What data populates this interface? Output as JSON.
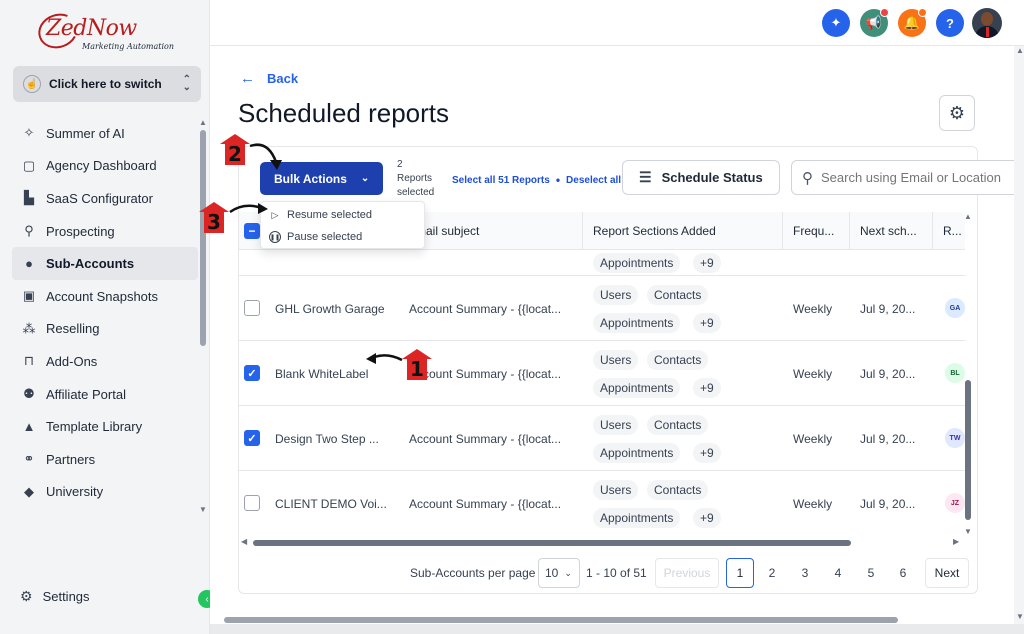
{
  "brand": {
    "logo_text": "ZedNow",
    "logo_tagline": "Marketing Automation",
    "accent": "#1e40af",
    "link": "#2563eb"
  },
  "switcher": {
    "label": "Click here to switch"
  },
  "sidebar": {
    "items": [
      {
        "label": "Summer of AI",
        "icon": "sparkle-icon"
      },
      {
        "label": "Agency Dashboard",
        "icon": "dashboard-icon"
      },
      {
        "label": "SaaS Configurator",
        "icon": "bar-chart-icon"
      },
      {
        "label": "Prospecting",
        "icon": "people-search-icon"
      },
      {
        "label": "Sub-Accounts",
        "icon": "user-icon",
        "active": true
      },
      {
        "label": "Account Snapshots",
        "icon": "snapshot-icon"
      },
      {
        "label": "Reselling",
        "icon": "network-icon"
      },
      {
        "label": "Add-Ons",
        "icon": "bag-icon"
      },
      {
        "label": "Affiliate Portal",
        "icon": "group-icon"
      },
      {
        "label": "Template Library",
        "icon": "shapes-icon"
      },
      {
        "label": "Partners",
        "icon": "handshake-icon"
      },
      {
        "label": "University",
        "icon": "graduation-cap-icon"
      }
    ],
    "settings_label": "Settings"
  },
  "topbar": {
    "icons": [
      "magic-wand-icon",
      "megaphone-icon",
      "bell-icon",
      "help-icon",
      "avatar"
    ],
    "help_glyph": "?"
  },
  "main": {
    "back_label": "Back",
    "title": "Scheduled reports",
    "bulk_actions_label": "Bulk Actions",
    "selection": {
      "count": "2",
      "line1": "Reports",
      "line2": "selected",
      "select_all": "Select all 51 Reports",
      "deselect_all": "Deselect all"
    },
    "schedule_status_label": "Schedule Status",
    "search_placeholder": "Search using Email or Location",
    "dropdown": {
      "resume": "Resume selected",
      "pause": "Pause selected"
    },
    "columns": [
      "",
      "Email subject",
      "Report Sections Added",
      "Frequ...",
      "Next sch...",
      "R..."
    ],
    "partial_row": {
      "chips": [
        "Appointments",
        "+9"
      ]
    },
    "rows": [
      {
        "checked": false,
        "name": "GHL Growth Garage",
        "subject": "Account Summary - {{locat...",
        "chips": [
          "Users",
          "Contacts",
          "Appointments",
          "+9"
        ],
        "frequency": "Weekly",
        "next": "Jul 9, 20...",
        "initials": "GA",
        "badge_bg": "#dbeafe",
        "badge_fg": "#1e3a8a"
      },
      {
        "checked": true,
        "name": "Blank WhiteLabel",
        "subject": "Account Summary - {{locat...",
        "chips": [
          "Users",
          "Contacts",
          "Appointments",
          "+9"
        ],
        "frequency": "Weekly",
        "next": "Jul 9, 20...",
        "initials": "BL",
        "badge_bg": "#dcfce7",
        "badge_fg": "#166534"
      },
      {
        "checked": true,
        "name": "Design Two Step ...",
        "subject": "Account Summary - {{locat...",
        "chips": [
          "Users",
          "Contacts",
          "Appointments",
          "+9"
        ],
        "frequency": "Weekly",
        "next": "Jul 9, 20...",
        "initials": "TW",
        "badge_bg": "#e0e7ff",
        "badge_fg": "#3730a3"
      },
      {
        "checked": false,
        "name": "CLIENT DEMO Voi...",
        "subject": "Account Summary - {{locat...",
        "chips": [
          "Users",
          "Contacts",
          "Appointments",
          "+9"
        ],
        "frequency": "Weekly",
        "next": "Jul 9, 20...",
        "initials": "JZ",
        "badge_bg": "#fce7f3",
        "badge_fg": "#9d174d"
      }
    ],
    "pagination": {
      "per_page_label": "Sub-Accounts per page",
      "per_page_value": "10",
      "range": "1 - 10 of 51",
      "previous": "Previous",
      "pages": [
        "1",
        "2",
        "3",
        "4",
        "5",
        "6"
      ],
      "current": "1",
      "next": "Next"
    }
  },
  "annotations": [
    "1",
    "2",
    "3"
  ]
}
